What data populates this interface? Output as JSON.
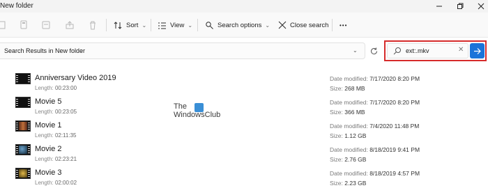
{
  "window": {
    "title": "New folder"
  },
  "toolbar": {
    "sort_label": "Sort",
    "view_label": "View",
    "search_options_label": "Search options",
    "close_search_label": "Close search",
    "more_label": "•••"
  },
  "address": {
    "text": "Search Results in New folder",
    "chevron": "›"
  },
  "search": {
    "query": "ext:.mkv",
    "clear": "✕",
    "go": "→"
  },
  "watermark": {
    "line1": "The",
    "line2": "WindowsClub"
  },
  "labels": {
    "length": "Length:",
    "date_modified": "Date modified:",
    "size": "Size:"
  },
  "files": [
    {
      "name": "Anniversary Video 2019",
      "length": "00:23:00",
      "date": "7/17/2020 8:20 PM",
      "size": "268 MB",
      "thumb": "#111111"
    },
    {
      "name": "Movie 5",
      "length": "00:23:05",
      "date": "7/17/2020 8:20 PM",
      "size": "366 MB",
      "thumb": "#111111"
    },
    {
      "name": "Movie 1",
      "length": "02:11:35",
      "date": "7/4/2020 11:48 PM",
      "size": "1.12 GB",
      "thumb": "#8a4a2a"
    },
    {
      "name": "Movie 2",
      "length": "02:23:21",
      "date": "8/18/2019 9:41 PM",
      "size": "2.76 GB",
      "thumb": "#1f4a6a"
    },
    {
      "name": "Movie 3",
      "length": "02:00:02",
      "date": "8/18/2019 4:57 PM",
      "size": "2.23 GB",
      "thumb": "#9a7a2a"
    }
  ],
  "colors": {
    "accent": "#1a73d9",
    "highlight": "#d62b2b"
  }
}
